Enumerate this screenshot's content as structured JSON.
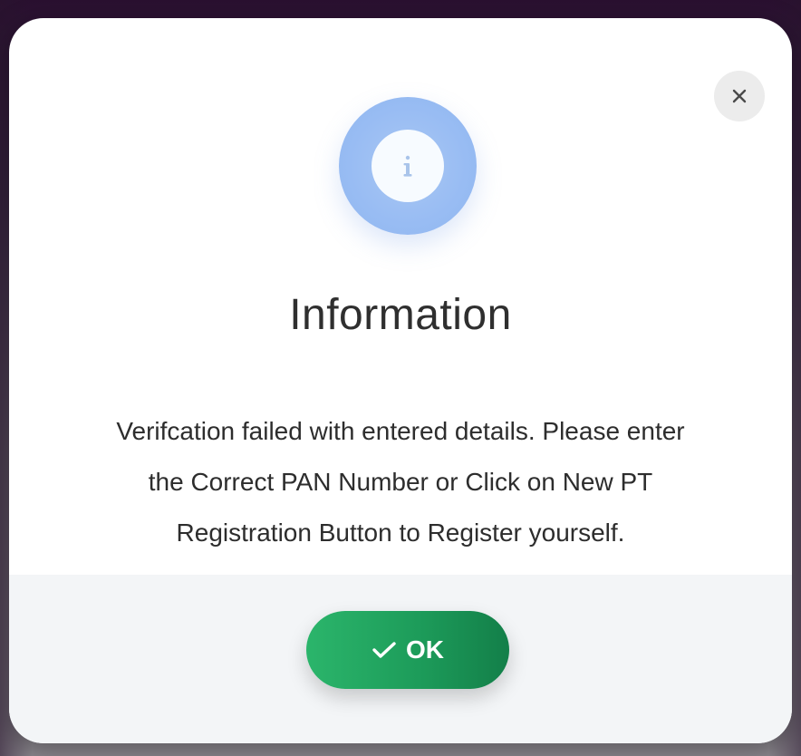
{
  "dialog": {
    "title": "Information",
    "message_lines": [
      "Verifcation failed with entered details. Please enter",
      "the Correct PAN Number or Click on New PT",
      "Registration Button to Register yourself."
    ],
    "ok_label": "OK"
  },
  "colors": {
    "accent_green": "#1d9c5a",
    "info_blue": "#98bcf3"
  },
  "icons": {
    "info": "info-icon",
    "close": "close-icon",
    "check": "check-icon"
  }
}
